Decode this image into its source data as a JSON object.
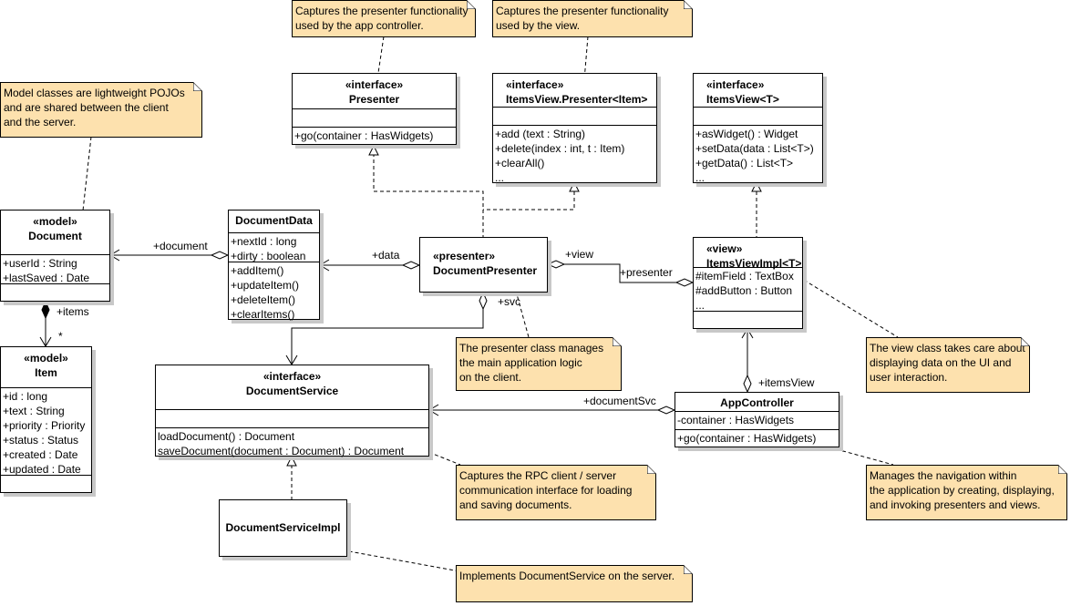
{
  "classes": {
    "presenter": {
      "stereotype": "«interface»",
      "name": "Presenter",
      "attributes": [],
      "operations": [
        "+go(container : HasWidgets)"
      ]
    },
    "itemsViewPresenter": {
      "stereotype": "«interface»",
      "name": "ItemsView.Presenter<Item>",
      "attributes": [],
      "operations": [
        "+add (text : String)",
        "+delete(index : int, t : Item)",
        "+clearAll()",
        "..."
      ]
    },
    "itemsView": {
      "stereotype": "«interface»",
      "name": "ItemsView<T>",
      "attributes": [],
      "operations": [
        "+asWidget() : Widget",
        "+setData(data : List<T>)",
        "+getData() : List<T>",
        "..."
      ]
    },
    "document": {
      "stereotype": "«model»",
      "name": "Document",
      "attributes": [
        "+userId : String",
        "+lastSaved : Date"
      ],
      "operations": []
    },
    "documentData": {
      "stereotype": "",
      "name": "DocumentData",
      "attributes": [
        "+nextId : long",
        "+dirty : boolean"
      ],
      "operations": [
        "+addItem()",
        "+updateItem()",
        "+deleteItem()",
        "+clearItems()"
      ]
    },
    "documentPresenter": {
      "stereotype": "«presenter»",
      "name": "DocumentPresenter"
    },
    "itemsViewImpl": {
      "stereotype": "«view»",
      "name": "ItemsViewImpl<T>",
      "attributes": [
        "#itemField : TextBox",
        "#addButton : Button",
        "..."
      ],
      "operations": []
    },
    "item": {
      "stereotype": "«model»",
      "name": "Item",
      "attributes": [
        "+id : long",
        "+text : String",
        "+priority : Priority",
        "+status : Status",
        "+created : Date",
        "+updated : Date"
      ],
      "operations": []
    },
    "documentService": {
      "stereotype": "«interface»",
      "name": "DocumentService",
      "attributes": [],
      "operations": [
        "loadDocument() : Document",
        "saveDocument(document : Document) : Document"
      ]
    },
    "appController": {
      "stereotype": "",
      "name": "AppController",
      "attributes": [
        "-container : HasWidgets"
      ],
      "operations": [
        "+go(container : HasWidgets)"
      ]
    },
    "documentServiceImpl": {
      "stereotype": "",
      "name": "DocumentServiceImpl"
    }
  },
  "notes": {
    "model": [
      "Model classes are lightweight POJOs",
      "and are shared between the client",
      "and the server."
    ],
    "presenterIf": [
      "Captures the presenter functionality",
      "used by the app controller."
    ],
    "viewPresenterIf": [
      "Captures the presenter functionality",
      "used by the view."
    ],
    "presenterClass": [
      "The presenter class manages",
      "the main application logic",
      "on the client."
    ],
    "viewClass": [
      "The view class takes care about",
      "displaying data on the UI and",
      "user interaction."
    ],
    "service": [
      "Captures the RPC client / server",
      "communication interface for loading",
      "and saving documents."
    ],
    "controller": [
      "Manages the navigation within",
      "the application by creating, displaying,",
      "and invoking presenters and views."
    ],
    "serviceImpl": [
      "Implements DocumentService on the server."
    ]
  },
  "labels": {
    "document": "+document",
    "data": "+data",
    "items": "+items",
    "itemsMultiplicity": "*",
    "view": "+view",
    "presenter": "+presenter",
    "svc": "+svc",
    "itemsView": "+itemsView",
    "documentSvc": "+documentSvc"
  },
  "colors": {
    "note": "#fde1ae",
    "shadow": "#c8c8c8",
    "line": "#000000"
  }
}
